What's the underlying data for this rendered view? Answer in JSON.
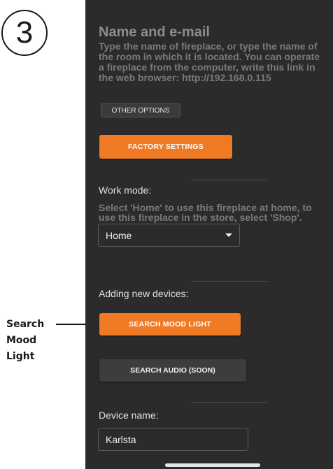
{
  "step": {
    "number": "3"
  },
  "header": {
    "title": "Name and e-mail",
    "description": "Type the name of fireplace, or type the name of the room in which it is located. You can operate a fireplace from the computer, write this link in the web browser: http://192.168.0.115"
  },
  "buttons": {
    "other_options": "OTHER OPTIONS",
    "factory_settings": "FACTORY SETTINGS",
    "search_mood_light": "SEARCH MOOD LIGHT",
    "search_audio": "SEARCH AUDIO (SOON)"
  },
  "work_mode": {
    "label": "Work mode:",
    "description": "Select 'Home' to use this fireplace at home, to use this fireplace in the store, select 'Shop'.",
    "selected": "Home"
  },
  "adding_devices": {
    "label": "Adding new devices:"
  },
  "device_name": {
    "label": "Device name:",
    "value": "Karlsta"
  },
  "callout": {
    "line1": "Search",
    "line2": "Mood",
    "line3": "Light"
  },
  "colors": {
    "accent": "#f07a24",
    "background": "#2b2b2b",
    "secondary_button": "#3d3d3d"
  }
}
